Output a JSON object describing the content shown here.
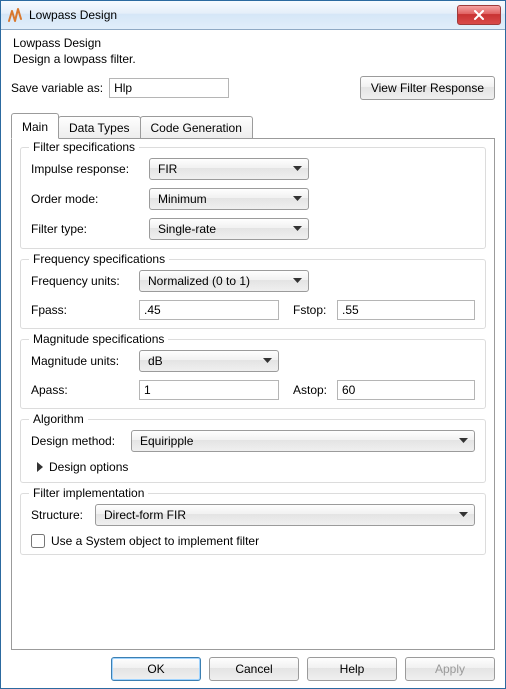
{
  "window": {
    "title": "Lowpass Design",
    "close_aria": "Close"
  },
  "header": {
    "title": "Lowpass Design",
    "description": "Design a lowpass filter."
  },
  "save_row": {
    "label": "Save variable as:",
    "value": "Hlp",
    "view_response_btn": "View Filter Response"
  },
  "tabs": {
    "main": "Main",
    "data_types": "Data Types",
    "code_gen": "Code Generation"
  },
  "filter_spec": {
    "legend": "Filter specifications",
    "impulse_label": "Impulse response:",
    "impulse_value": "FIR",
    "order_label": "Order mode:",
    "order_value": "Minimum",
    "type_label": "Filter type:",
    "type_value": "Single-rate"
  },
  "freq_spec": {
    "legend": "Frequency specifications",
    "units_label": "Frequency units:",
    "units_value": "Normalized (0 to 1)",
    "fpass_label": "Fpass:",
    "fpass_value": ".45",
    "fstop_label": "Fstop:",
    "fstop_value": ".55"
  },
  "mag_spec": {
    "legend": "Magnitude specifications",
    "units_label": "Magnitude units:",
    "units_value": "dB",
    "apass_label": "Apass:",
    "apass_value": "1",
    "astop_label": "Astop:",
    "astop_value": "60"
  },
  "algorithm": {
    "legend": "Algorithm",
    "method_label": "Design method:",
    "method_value": "Equiripple",
    "options_label": "Design options"
  },
  "impl": {
    "legend": "Filter implementation",
    "structure_label": "Structure:",
    "structure_value": "Direct-form FIR",
    "sysobj_label": "Use a System object to implement filter",
    "sysobj_checked": false
  },
  "footer": {
    "ok": "OK",
    "cancel": "Cancel",
    "help": "Help",
    "apply": "Apply"
  }
}
